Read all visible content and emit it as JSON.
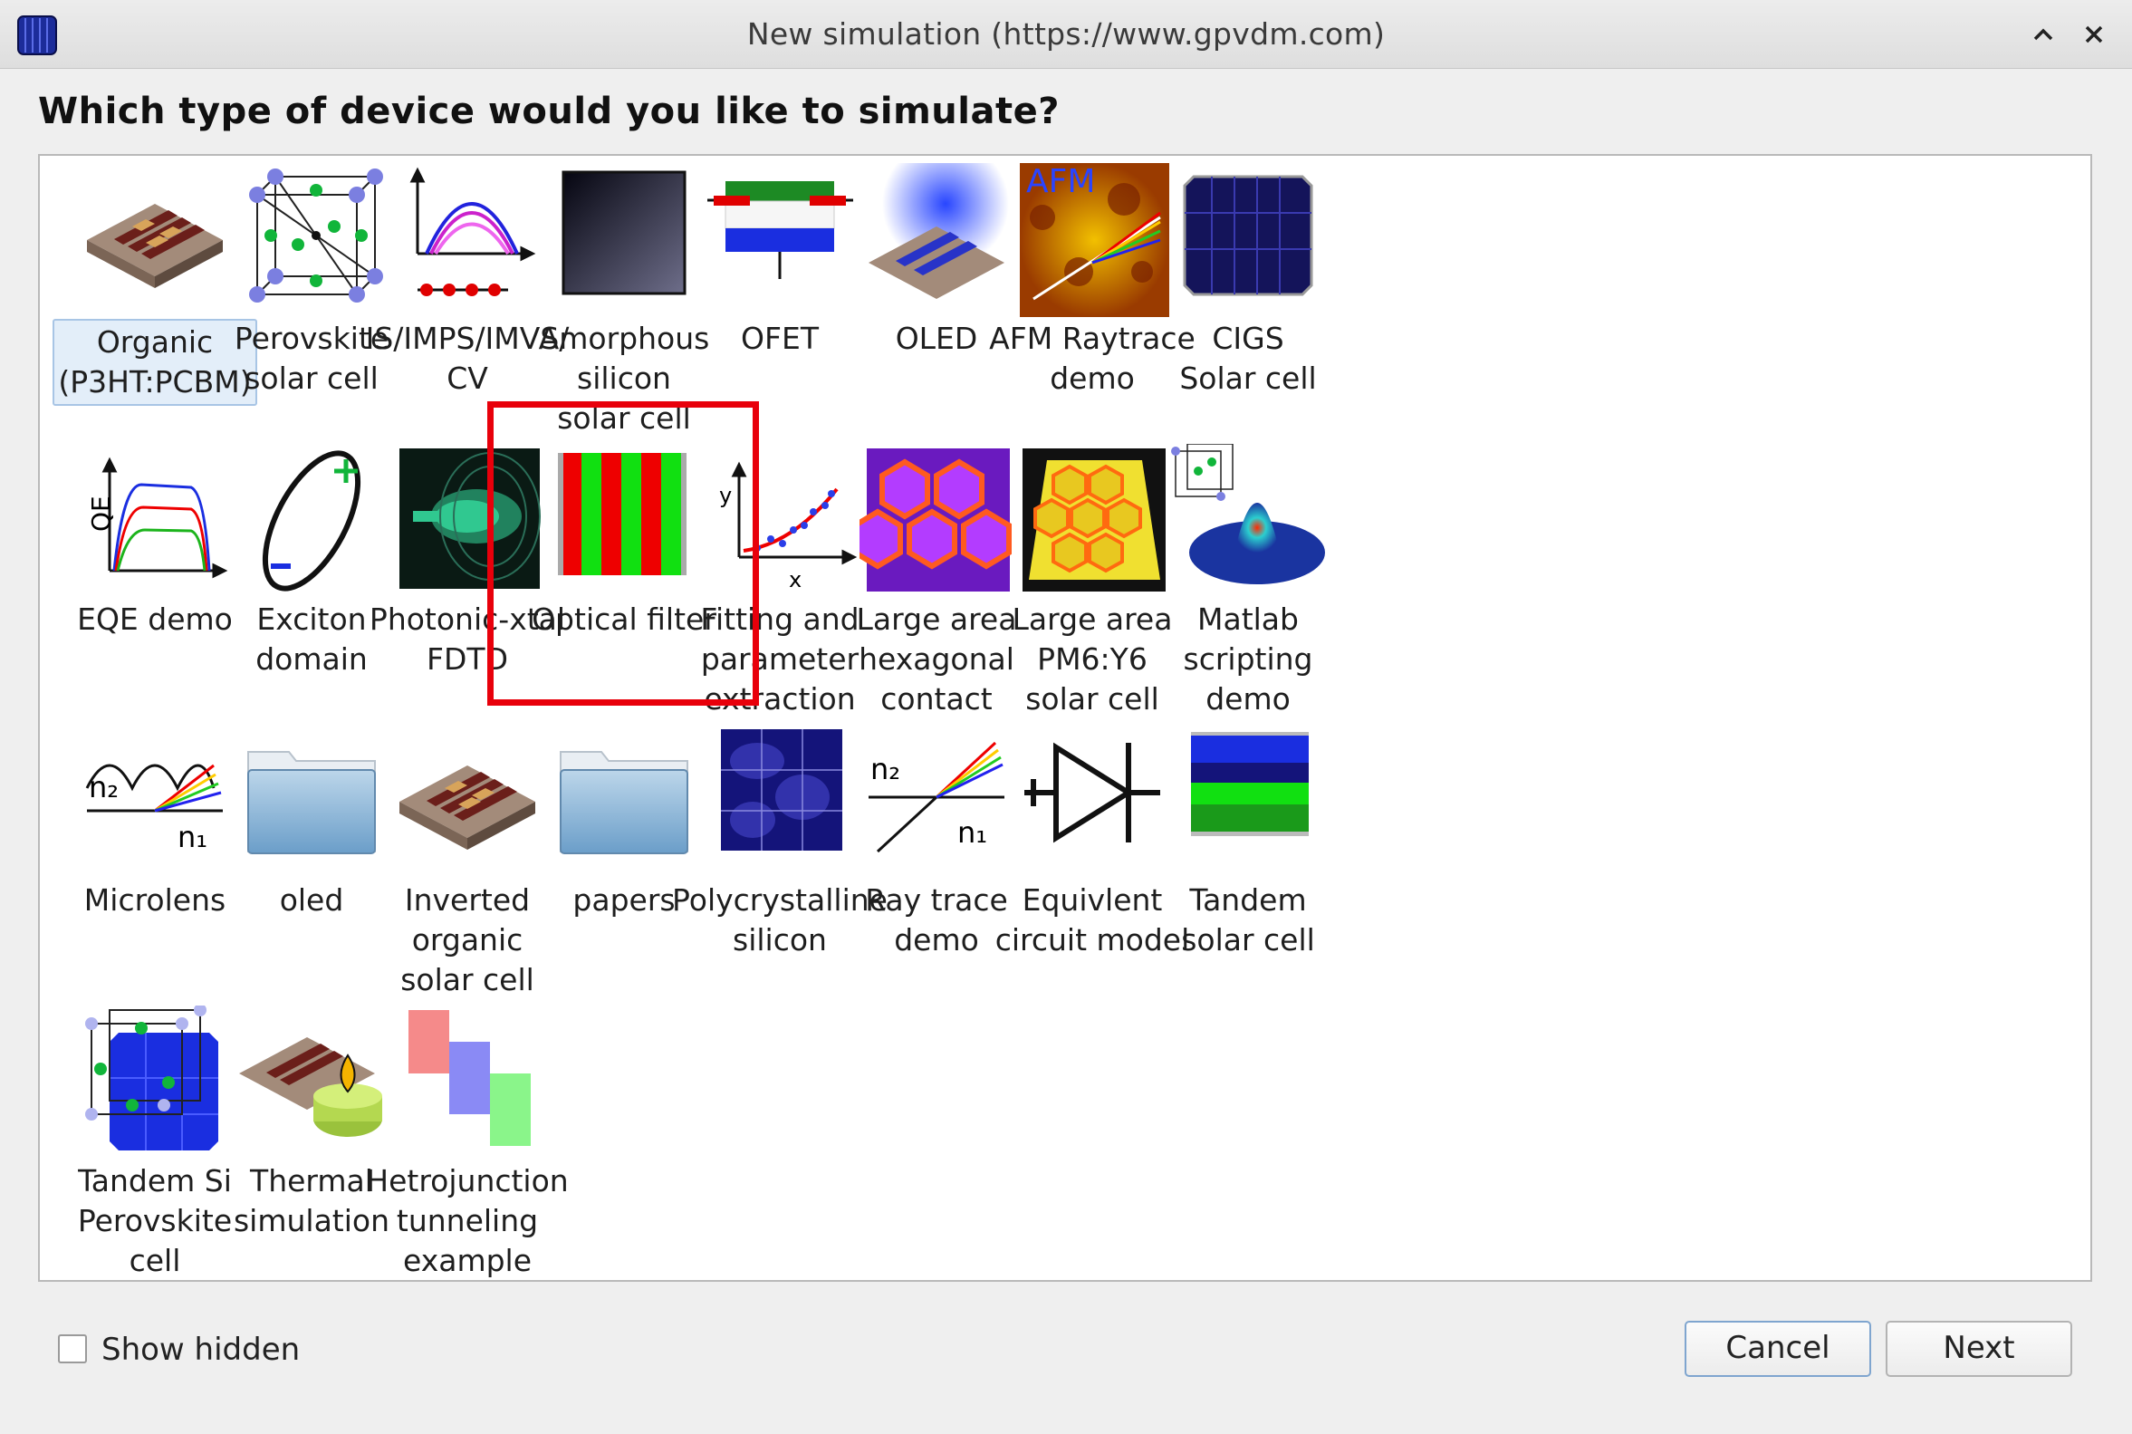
{
  "window": {
    "title": "New simulation (https://www.gpvdm.com)",
    "app_icon": "gpvdm-grid-icon",
    "controls": [
      "maximize-icon",
      "close-icon"
    ]
  },
  "question": "Which type of device would you like to simulate?",
  "devices": [
    {
      "id": "organic",
      "lines": [
        "Organic",
        "(P3HT:PCBM)"
      ],
      "icon": "organic-device-icon",
      "selected": true
    },
    {
      "id": "perovskite",
      "lines": [
        "Perovskite",
        "solar cell"
      ],
      "icon": "perovskite-crystal-icon"
    },
    {
      "id": "is-imps",
      "lines": [
        "IS/IMPS/IMVS/",
        "CV"
      ],
      "icon": "impedance-arcs-icon"
    },
    {
      "id": "amorphous",
      "lines": [
        "Amorphous",
        "silicon",
        "solar cell"
      ],
      "icon": "dark-panel-icon"
    },
    {
      "id": "ofet",
      "lines": [
        "OFET"
      ],
      "icon": "transistor-layers-icon"
    },
    {
      "id": "oled",
      "lines": [
        "OLED"
      ],
      "icon": "oled-glow-icon"
    },
    {
      "id": "afm",
      "lines": [
        "AFM Raytrace",
        "demo"
      ],
      "icon": "afm-raytrace-icon"
    },
    {
      "id": "cigs",
      "lines": [
        "CIGS",
        "Solar cell"
      ],
      "icon": "solar-panel-icon"
    },
    {
      "id": "eqe",
      "lines": [
        "EQE demo"
      ],
      "icon": "qe-curve-icon"
    },
    {
      "id": "exciton",
      "lines": [
        "Exciton",
        "domain"
      ],
      "icon": "exciton-ellipse-icon"
    },
    {
      "id": "photonic",
      "lines": [
        "Photonic-xtal",
        "FDTD"
      ],
      "icon": "fdtd-field-icon",
      "highlighted": true
    },
    {
      "id": "optical-filter",
      "lines": [
        "Optical filter"
      ],
      "icon": "stripe-filter-icon"
    },
    {
      "id": "fitting",
      "lines": [
        "Fitting and",
        "parameter",
        "extraction"
      ],
      "icon": "fit-scatter-icon"
    },
    {
      "id": "hex-contact",
      "lines": [
        "Large area",
        "hexagonal",
        "contact"
      ],
      "icon": "hexagon-contact-icon"
    },
    {
      "id": "pm6y6",
      "lines": [
        "Large area",
        "PM6:Y6",
        "solar cell"
      ],
      "icon": "hexagon-panel-icon"
    },
    {
      "id": "matlab",
      "lines": [
        "Matlab",
        "scripting",
        "demo"
      ],
      "icon": "matlab-surface-icon"
    },
    {
      "id": "microlens",
      "lines": [
        "Microlens"
      ],
      "icon": "microlens-icon"
    },
    {
      "id": "oled-folder",
      "lines": [
        "oled"
      ],
      "icon": "folder-icon"
    },
    {
      "id": "inverted",
      "lines": [
        "Inverted",
        "organic",
        "solar cell"
      ],
      "icon": "organic-device-icon"
    },
    {
      "id": "papers-folder",
      "lines": [
        "papers"
      ],
      "icon": "folder-icon"
    },
    {
      "id": "polycrystalline",
      "lines": [
        "Polycrystalline",
        "silicon"
      ],
      "icon": "polysilicon-icon"
    },
    {
      "id": "raytrace",
      "lines": [
        "Ray trace",
        "demo"
      ],
      "icon": "ray-refraction-icon"
    },
    {
      "id": "circuit",
      "lines": [
        "Equivlent",
        "circuit model"
      ],
      "icon": "diode-icon"
    },
    {
      "id": "tandem",
      "lines": [
        "Tandem",
        "solar cell"
      ],
      "icon": "tandem-layers-icon"
    },
    {
      "id": "tandem-si",
      "lines": [
        "Tandem Si",
        "Perovskite",
        "cell"
      ],
      "icon": "tandem-crystal-panel-icon"
    },
    {
      "id": "thermal",
      "lines": [
        "Thermal",
        "simulation"
      ],
      "icon": "thermal-candle-icon"
    },
    {
      "id": "hetrojunction",
      "lines": [
        "Hetrojunction",
        "tunneling",
        "example"
      ],
      "icon": "band-blocks-icon"
    }
  ],
  "footer": {
    "show_hidden_label": "Show hidden",
    "show_hidden_checked": false,
    "cancel_label": "Cancel",
    "next_label": "Next"
  }
}
